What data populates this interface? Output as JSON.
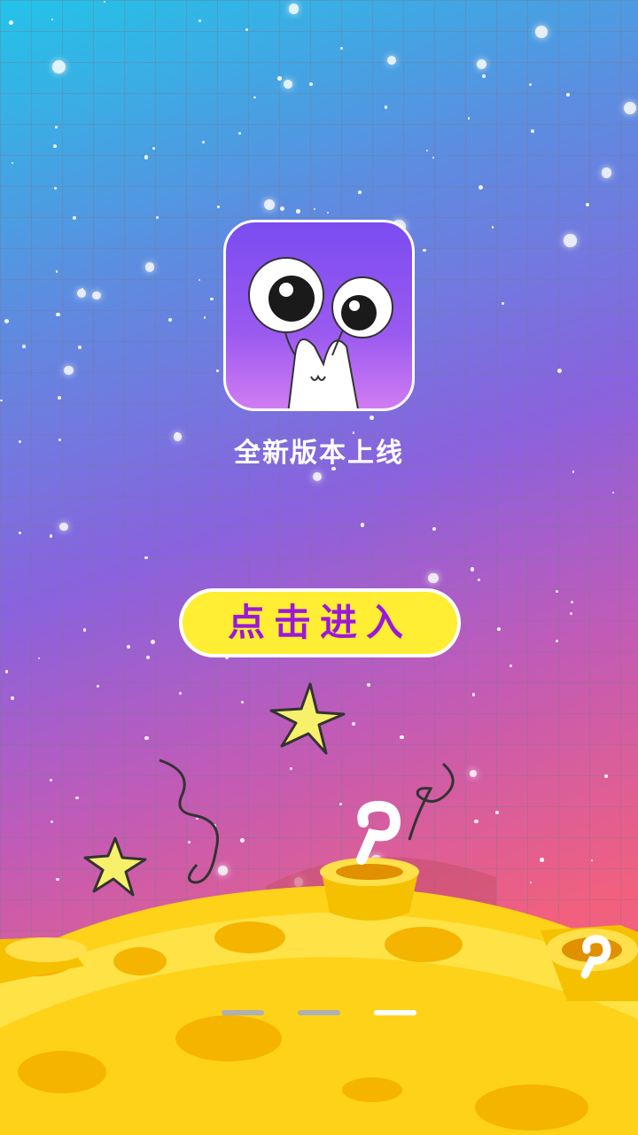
{
  "splash": {
    "tagline": "全新版本上线",
    "enter_button_label": "点击进入"
  },
  "app_icon": {
    "name": "snail-mascot-icon",
    "gradient_top": "#7b4cf0",
    "gradient_bottom": "#d07cf2"
  },
  "colors": {
    "button_fill": "#ffee33",
    "button_text": "#9b18d8",
    "planet_yellow": "#ffd21a"
  },
  "page_indicator": {
    "count": 3,
    "active_index": 2
  }
}
